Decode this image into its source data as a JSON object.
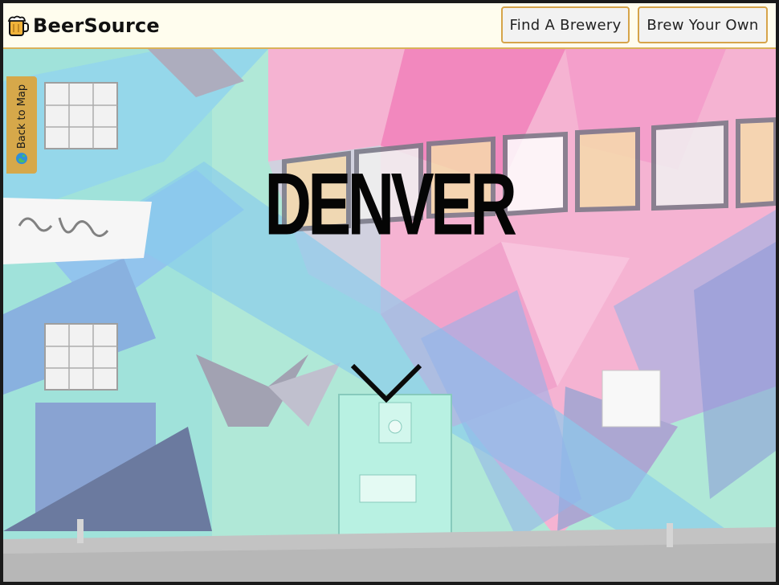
{
  "brand": {
    "name": "BeerSource",
    "icon": "beer-mug-icon"
  },
  "nav": {
    "find_label": "Find A Brewery",
    "brew_label": "Brew Your Own"
  },
  "sidebar_tab": {
    "label": "Back to Map",
    "icon": "globe-icon"
  },
  "hero": {
    "title": "DENVER",
    "scroll_icon": "chevron-down-icon",
    "background_image": "denver-mural-photo"
  },
  "colors": {
    "header_bg": "#fffdee",
    "accent_gold": "#d6a84a",
    "button_bg": "#f2f2f2"
  }
}
